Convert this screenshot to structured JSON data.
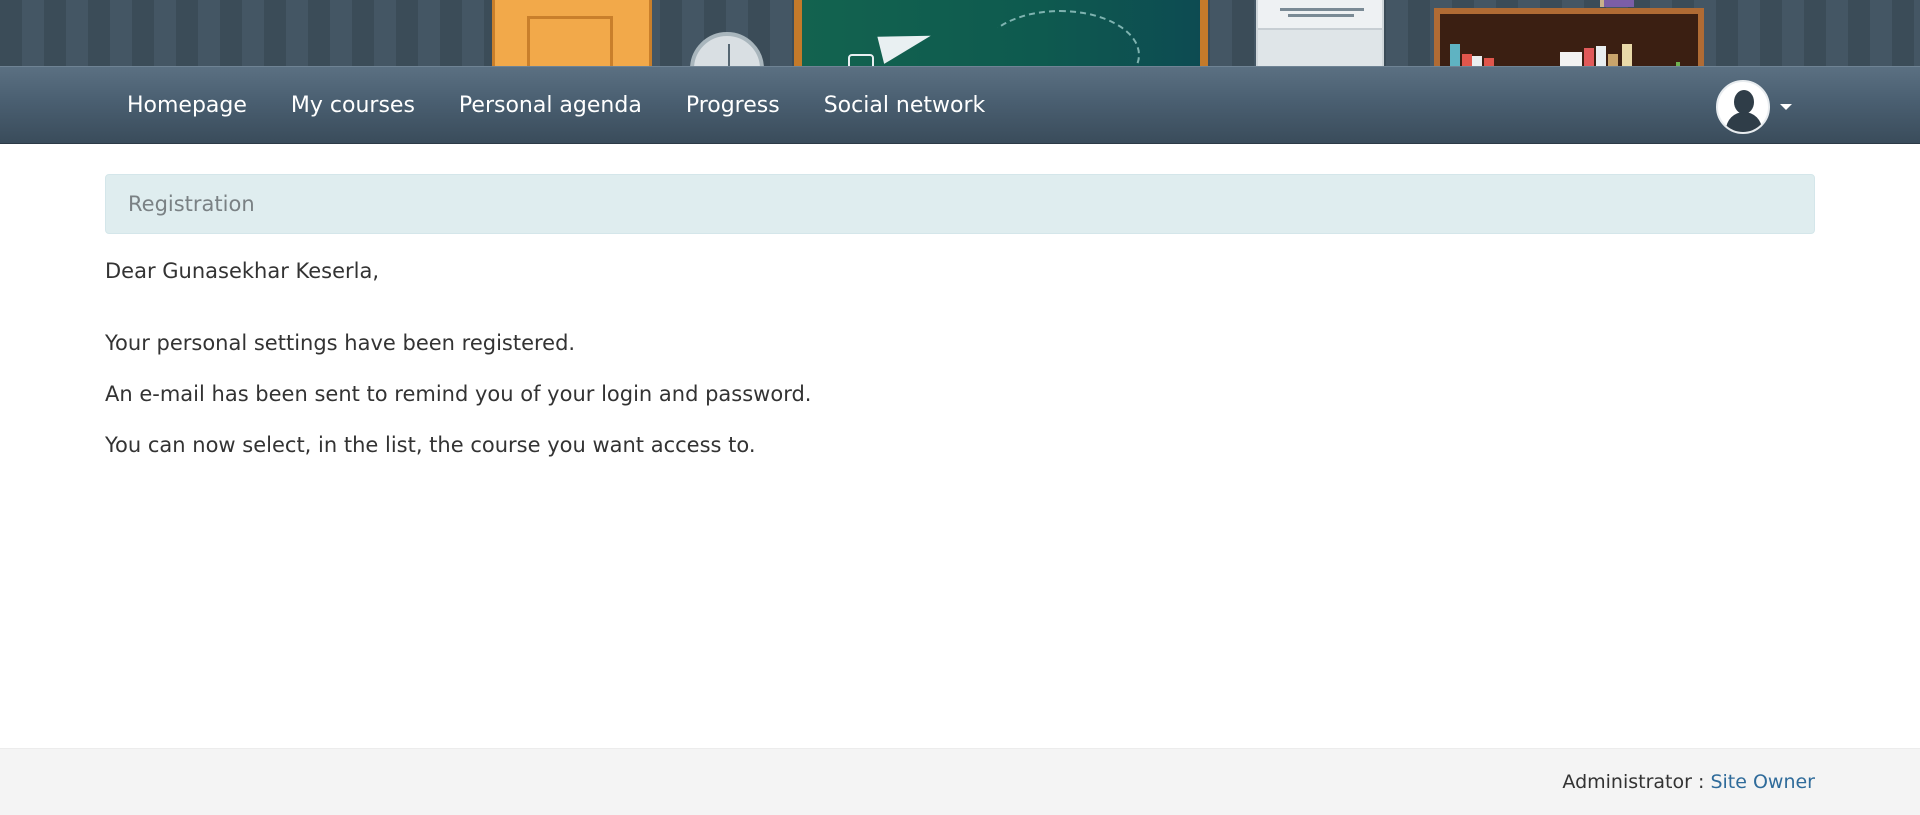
{
  "navbar": {
    "items": [
      {
        "label": "Homepage"
      },
      {
        "label": "My courses"
      },
      {
        "label": "Personal agenda"
      },
      {
        "label": "Progress"
      },
      {
        "label": "Social network"
      }
    ],
    "user_avatar_icon": "user-silhouette-icon",
    "dropdown_icon": "caret-down-icon"
  },
  "panel": {
    "title": "Registration"
  },
  "message": {
    "greeting": "Dear Gunasekhar Keserla,",
    "lines": [
      "Your personal settings have been registered.",
      "An e-mail has been sent to remind you of your login and password.",
      "You can now select, in the list, the course you want access to."
    ]
  },
  "footer": {
    "admin_label": "Administrator :",
    "admin_name": "Site Owner"
  },
  "colors": {
    "navbar": "#4a5f71",
    "panel_bg": "#dfedef",
    "link": "#2f6b9a",
    "footer_bg": "#f4f4f4"
  }
}
